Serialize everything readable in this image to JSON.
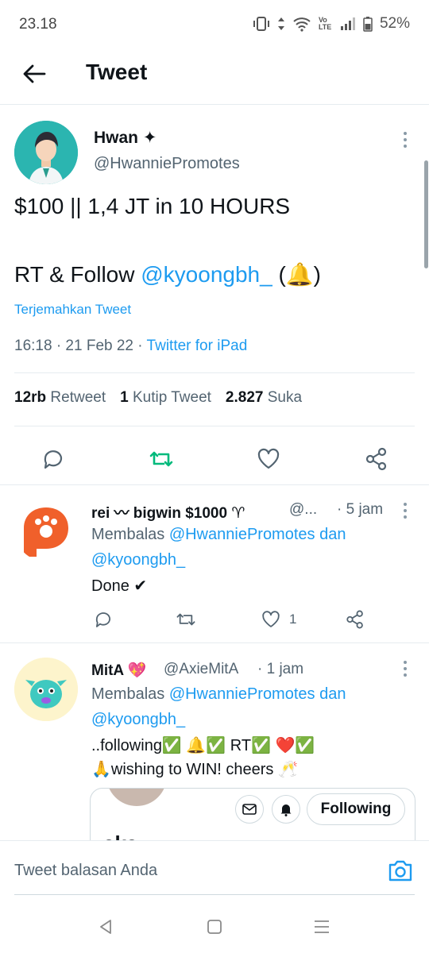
{
  "status_bar": {
    "time": "23.18",
    "battery": "52%",
    "network_label": "Vo LTE"
  },
  "header": {
    "title": "Tweet"
  },
  "main_tweet": {
    "name": "Hwan ✦",
    "handle": "@HwanniePromotes",
    "line1": "$100 || 1,4 JT in 10 HOURS",
    "line2_prefix": "RT & Follow ",
    "line2_mention": "@kyoongbh_",
    "line2_suffix": " (🔔)",
    "translate": "Terjemahkan Tweet",
    "meta_time": "16:18 · 21 Feb 22 · ",
    "meta_source": "Twitter for iPad",
    "stats": {
      "retweets_count": "12rb",
      "retweets_label": "Retweet",
      "quotes_count": "1",
      "quotes_label": "Kutip Tweet",
      "likes_count": "2.827",
      "likes_label": "Suka"
    }
  },
  "replies": [
    {
      "name": "rei 〰 bigwin $1000 ♈",
      "handle": "@...",
      "time": "· 5 jam",
      "replying_prefix": "Membalas ",
      "replying_user1": "@HwanniePromotes",
      "replying_and": " dan",
      "replying_user2": "@kyoongbh_",
      "text": "Done ✔",
      "like_count": "1"
    },
    {
      "name": "MitA 💖",
      "handle": "@AxieMitA",
      "time": "· 1 jam",
      "replying_prefix": "Membalas ",
      "replying_user1": "@HwanniePromotes",
      "replying_and": " dan",
      "replying_user2": "@kyoongbh_",
      "text_line1": "..following✅ 🔔✅ RT✅ ❤️✅",
      "text_line2": "🙏wishing to WIN! cheers 🥂",
      "quoted_follow_label": "Following",
      "quoted_text": "aka"
    }
  ],
  "compose": {
    "placeholder": "Tweet balasan Anda"
  },
  "colors": {
    "accent": "#1d9bf0",
    "retweet_green": "#00ba7c",
    "text": "#0f1419",
    "muted": "#536471"
  }
}
